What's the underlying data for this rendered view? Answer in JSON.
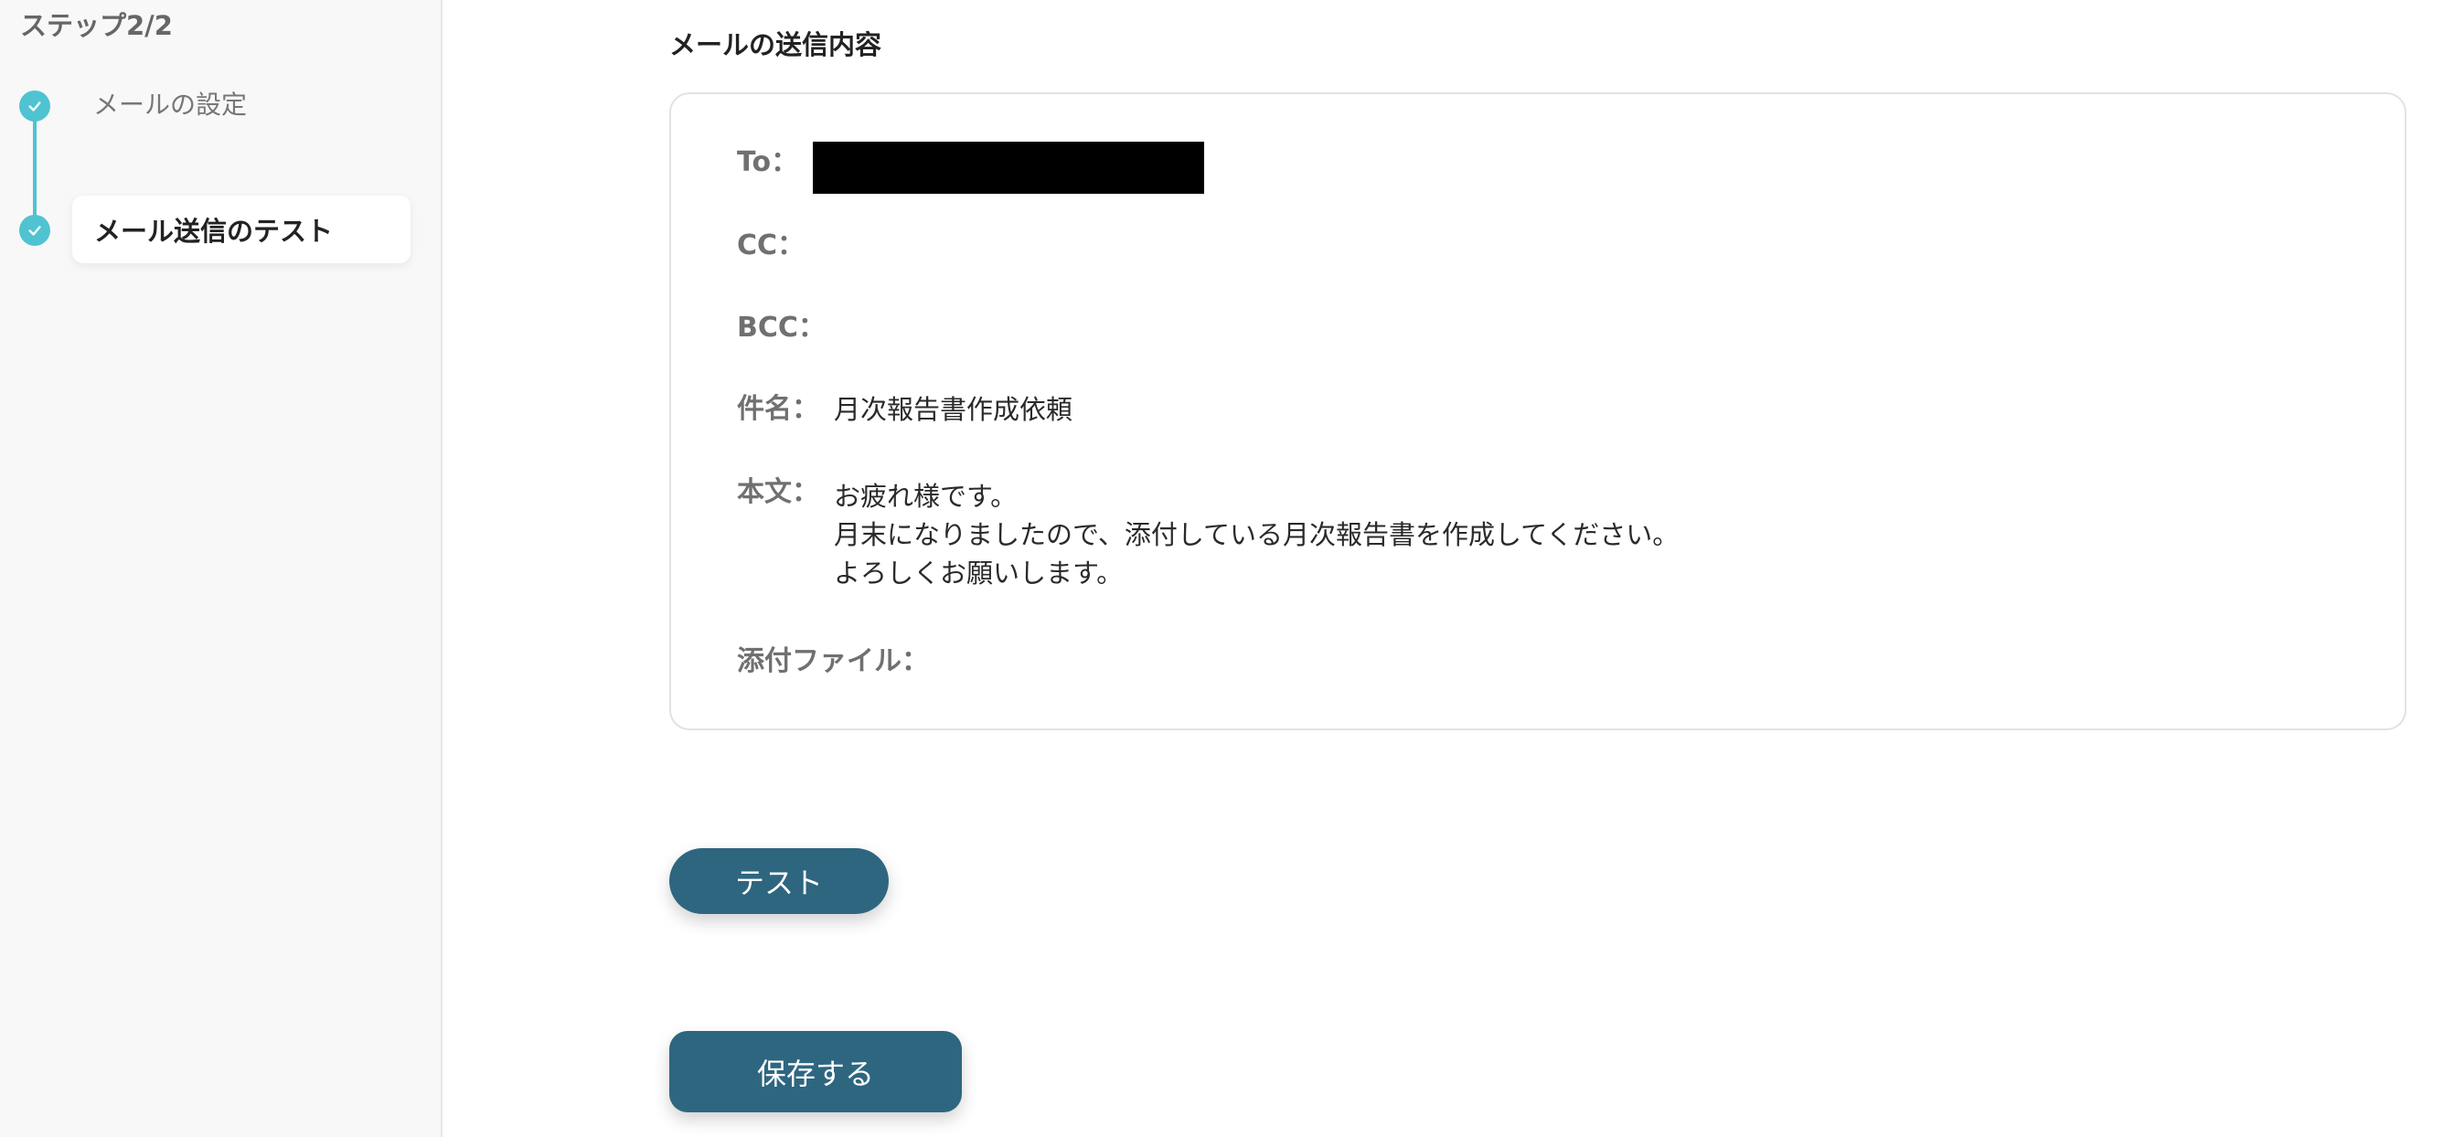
{
  "sidebar": {
    "step_title": "ステップ2/2",
    "steps": [
      {
        "label": "メールの設定",
        "status": "completed"
      },
      {
        "label": "メール送信のテスト",
        "status": "current"
      }
    ]
  },
  "main": {
    "section_title": "メールの送信内容",
    "mail": {
      "to_label": "To：",
      "cc_label": "CC：",
      "bcc_label": "BCC：",
      "subject_label": "件名：",
      "subject_value": "月次報告書作成依頼",
      "body_label": "本文：",
      "body_lines": [
        "お疲れ様です。",
        "月末になりましたので、添付している月次報告書を作成してください。",
        "よろしくお願いします。"
      ],
      "attachment_label": "添付ファイル："
    },
    "buttons": {
      "test_label": "テスト",
      "save_label": "保存する"
    }
  },
  "colors": {
    "accent_teal": "#4fc3d1",
    "button_blue": "#2e6680",
    "redaction": "#000000"
  }
}
